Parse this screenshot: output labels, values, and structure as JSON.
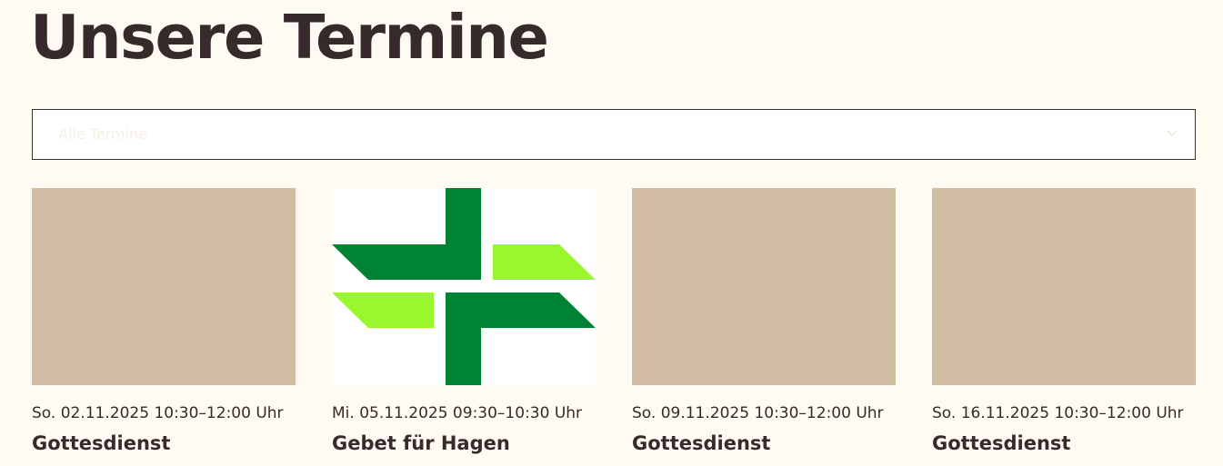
{
  "page": {
    "title": "Unsere Termine"
  },
  "filter": {
    "selected": "Alle Termine",
    "icon": "chevron-down-icon"
  },
  "events": [
    {
      "date": "So. 02.11.2025 10:30–12:00 Uhr",
      "title": "Gottesdienst",
      "image": "placeholder"
    },
    {
      "date": "Mi. 05.11.2025 09:30–10:30 Uhr",
      "title": "Gebet für Hagen",
      "image": "cross-logo"
    },
    {
      "date": "So. 09.11.2025 10:30–12:00 Uhr",
      "title": "Gottesdienst",
      "image": "placeholder"
    },
    {
      "date": "So. 16.11.2025 10:30–12:00 Uhr",
      "title": "Gottesdienst",
      "image": "placeholder"
    }
  ],
  "colors": {
    "background": "#FFFBF3",
    "text": "#362A2A",
    "placeholder": "#D1BDA4",
    "logo_dark_green": "#008235",
    "logo_light_green": "#9BF72D"
  }
}
